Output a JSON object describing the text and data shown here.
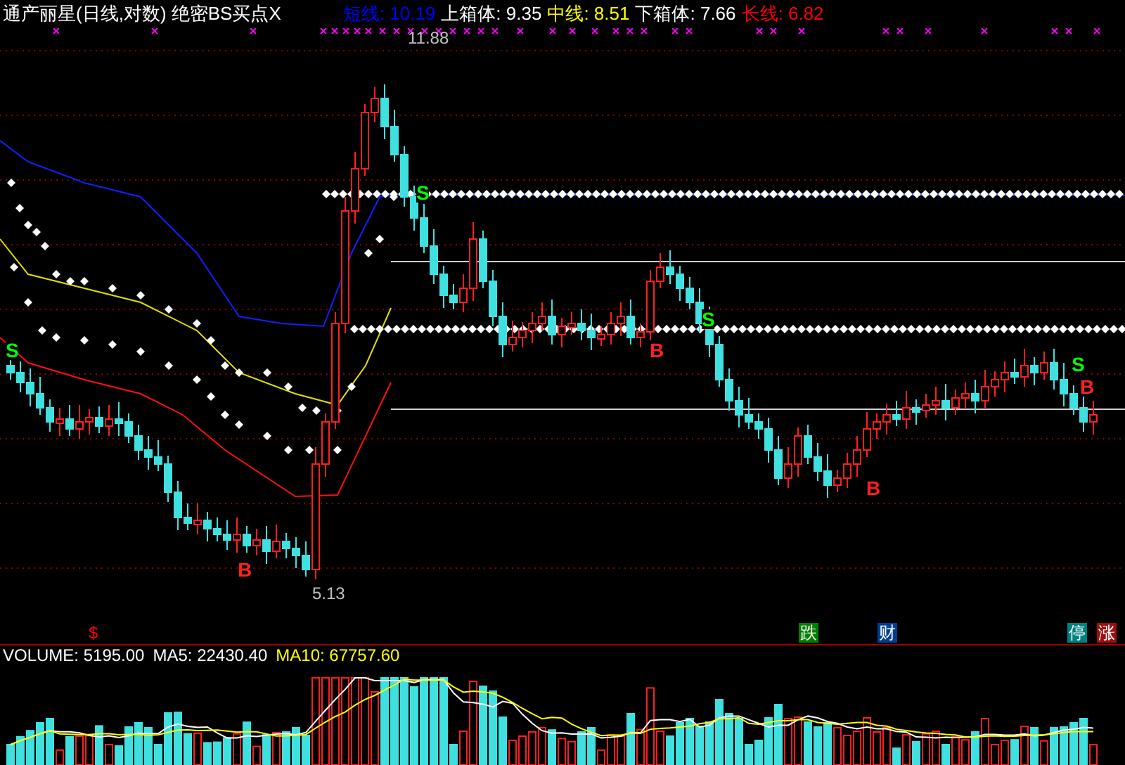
{
  "title": "通产丽星(日线,对数) 绝密BS买点X",
  "legend": [
    {
      "label": "短线: 10.19",
      "color": "#0000ff"
    },
    {
      "label": "上箱体: 9.35",
      "color": "#ffffff"
    },
    {
      "label": "中线: 8.51",
      "color": "#ffff00"
    },
    {
      "label": "下箱体: 7.66",
      "color": "#ffffff"
    },
    {
      "label": "长线: 6.82",
      "color": "#ff0000"
    }
  ],
  "price_labels": [
    {
      "kind": "high",
      "text": "11.88"
    },
    {
      "kind": "low",
      "text": "5.13"
    }
  ],
  "signals": [
    {
      "kind": "sell",
      "text": "S"
    },
    {
      "kind": "buy",
      "text": "B"
    },
    {
      "kind": "sell",
      "text": "S"
    },
    {
      "kind": "buy",
      "text": "B"
    },
    {
      "kind": "sell",
      "text": "S"
    },
    {
      "kind": "buy",
      "text": "B"
    },
    {
      "kind": "sell",
      "text": "S"
    },
    {
      "kind": "buy",
      "text": "B"
    }
  ],
  "event_marks": [
    {
      "text": "$",
      "color": "#ff0000"
    },
    {
      "text": "跌",
      "color": "#008000"
    },
    {
      "text": "财",
      "color": "#003f8f"
    },
    {
      "text": "停",
      "color": "#008080"
    },
    {
      "text": "涨",
      "color": "#9a1010"
    }
  ],
  "volume_header": [
    {
      "label": "VOLUME: 5195.00",
      "color": "#ffffff"
    },
    {
      "label": "MA5: 22430.40",
      "color": "#ffffff"
    },
    {
      "label": "MA10: 67757.60",
      "color": "#ffff00"
    }
  ]
}
